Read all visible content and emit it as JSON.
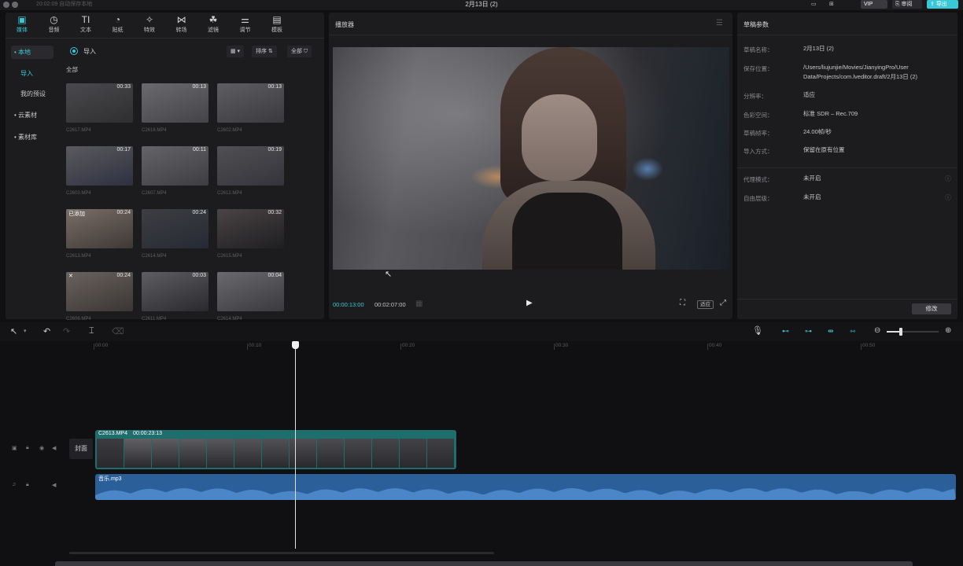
{
  "window": {
    "title": "2月13日 (2)",
    "autosave": "20:02:09  自动保存本地",
    "toolbar_right": {
      "layout_btn": "⊞",
      "review": "审阅",
      "export": "导出"
    }
  },
  "top_tools": [
    {
      "icon": "media-icon",
      "glyph": "▣",
      "label": "媒体",
      "active": true
    },
    {
      "icon": "audio-icon",
      "glyph": "◷",
      "label": "音频"
    },
    {
      "icon": "text-icon",
      "glyph": "TI",
      "label": "文本"
    },
    {
      "icon": "sticker-icon",
      "glyph": "◔",
      "label": "贴纸"
    },
    {
      "icon": "effects-icon",
      "glyph": "✧",
      "label": "特效"
    },
    {
      "icon": "transition-icon",
      "glyph": "⋈",
      "label": "转场"
    },
    {
      "icon": "filter-icon",
      "glyph": "☘",
      "label": "滤镜"
    },
    {
      "icon": "adjust-icon",
      "glyph": "⚌",
      "label": "调节"
    },
    {
      "icon": "template-icon",
      "glyph": "▤",
      "label": "模板"
    }
  ],
  "media_sidebar": {
    "items": [
      {
        "label": "• 本地",
        "selected": true
      },
      {
        "label": "导入",
        "accent": true
      },
      {
        "label": "我的预设"
      },
      {
        "label": "• 云素材"
      },
      {
        "label": "• 素材库"
      }
    ]
  },
  "media_panel": {
    "import_label": "导入",
    "sort_label": "排序",
    "all_label": "全部",
    "section_all": "全部",
    "clips": [
      {
        "name": "C2617.MP4",
        "dur": "00:33"
      },
      {
        "name": "C2616.MP4",
        "dur": "00:13"
      },
      {
        "name": "C2602.MP4",
        "dur": "00:13"
      },
      {
        "name": "C2603.MP4",
        "dur": "00:17"
      },
      {
        "name": "C2607.MP4",
        "dur": "00:11"
      },
      {
        "name": "C2612.MP4",
        "dur": "00:19"
      },
      {
        "name": "C2613.MP4",
        "dur": "00:24",
        "tag": "已添加"
      },
      {
        "name": "C2614.MP4",
        "dur": "00:24"
      },
      {
        "name": "C2615.MP4",
        "dur": "00:32"
      },
      {
        "name": "C2606.MP4",
        "dur": "00:24",
        "tag": "✕"
      },
      {
        "name": "C2611.MP4",
        "dur": "00:03"
      },
      {
        "name": "C2614.MP4",
        "dur": "00:04"
      }
    ]
  },
  "player": {
    "title": "播放器",
    "current_time": "00:00:13:00",
    "total_time": "00:02:07:00",
    "ratio_label": "适应"
  },
  "draft": {
    "title": "草稿参数",
    "rows": [
      {
        "label": "草稿名称：",
        "value": "2月13日 (2)"
      },
      {
        "label": "保存位置：",
        "value": "/Users/liujunjie/Movies/JianyingPro/User Data/Projects/com.lveditor.draft/2月13日 (2)"
      },
      {
        "label": "分辨率：",
        "value": "适应"
      },
      {
        "label": "色彩空间：",
        "value": "标准 SDR – Rec.709"
      },
      {
        "label": "草稿帧率：",
        "value": "24.00帧/秒"
      },
      {
        "label": "导入方式：",
        "value": "保留在原有位置"
      },
      {
        "label": "代理模式：",
        "value": "未开启"
      },
      {
        "label": "自由层级：",
        "value": "未开启"
      }
    ],
    "modify_label": "修改"
  },
  "timeline": {
    "ruler": [
      "00:00",
      "00:10",
      "00:20",
      "00:30",
      "00:40",
      "00:50"
    ],
    "cover_label": "封面",
    "video_clip": {
      "name": "C2613.MP4",
      "duration": "00:00:23:13"
    },
    "audio_clip": {
      "name": "音乐.mp3"
    },
    "playhead_time": "00:00:13:00"
  },
  "colors": {
    "accent": "#3bc8d6",
    "video_track": "#1f6e6e",
    "audio_track": "#2a6fb0"
  }
}
